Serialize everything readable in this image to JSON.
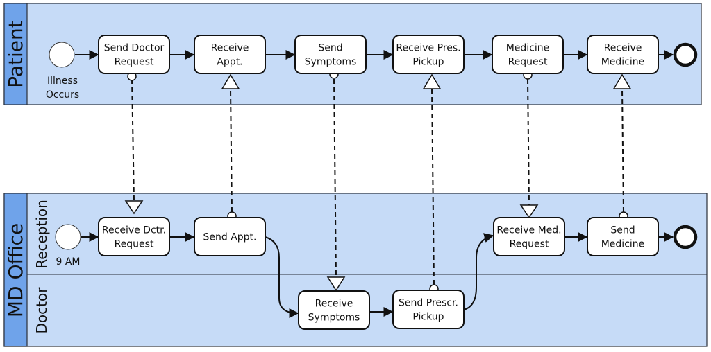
{
  "diagram": {
    "type": "BPMN collaboration",
    "pools": [
      {
        "id": "patient",
        "title": "Patient",
        "lanes": [],
        "start_event": {
          "label": "Illness\nOccurs"
        },
        "tasks": [
          {
            "id": "p1",
            "label": "Send Doctor\nRequest"
          },
          {
            "id": "p2",
            "label": "Receive\nAppt."
          },
          {
            "id": "p3",
            "label": "Send\nSymptoms"
          },
          {
            "id": "p4",
            "label": "Receive Pres.\nPickup"
          },
          {
            "id": "p5",
            "label": "Medicine\nRequest"
          },
          {
            "id": "p6",
            "label": "Receive\nMedicine"
          }
        ],
        "end_event": {
          "label": ""
        }
      },
      {
        "id": "md-office",
        "title": "MD Office",
        "lanes": [
          {
            "id": "reception",
            "title": "Reception",
            "start_event": {
              "label": "9 AM"
            },
            "tasks": [
              {
                "id": "r1",
                "label": "Receive Dctr.\nRequest"
              },
              {
                "id": "r2",
                "label": "Send Appt."
              },
              {
                "id": "r3",
                "label": "Receive Med.\nRequest"
              },
              {
                "id": "r4",
                "label": "Send\nMedicine"
              }
            ],
            "end_event": {
              "label": ""
            }
          },
          {
            "id": "doctor",
            "title": "Doctor",
            "tasks": [
              {
                "id": "d1",
                "label": "Receive\nSymptoms"
              },
              {
                "id": "d2",
                "label": "Send Prescr.\nPickup"
              }
            ]
          }
        ]
      }
    ],
    "sequence_flows": [
      [
        "p-start",
        "p1"
      ],
      [
        "p1",
        "p2"
      ],
      [
        "p2",
        "p3"
      ],
      [
        "p3",
        "p4"
      ],
      [
        "p4",
        "p5"
      ],
      [
        "p5",
        "p6"
      ],
      [
        "p6",
        "p-end"
      ],
      [
        "r-start",
        "r1"
      ],
      [
        "r1",
        "r2"
      ],
      [
        "r2",
        "d1"
      ],
      [
        "d1",
        "d2"
      ],
      [
        "d2",
        "r3"
      ],
      [
        "r3",
        "r4"
      ],
      [
        "r4",
        "r-end"
      ]
    ],
    "message_flows": [
      [
        "p1",
        "r1"
      ],
      [
        "r2",
        "p2"
      ],
      [
        "p3",
        "d1"
      ],
      [
        "d2",
        "p4"
      ],
      [
        "p5",
        "r3"
      ],
      [
        "r4",
        "p6"
      ]
    ],
    "colors": {
      "pool_background": "#c6dbf7",
      "pool_header": "#6fa3ea",
      "task_fill": "#ffffff",
      "stroke": "#111111"
    }
  }
}
